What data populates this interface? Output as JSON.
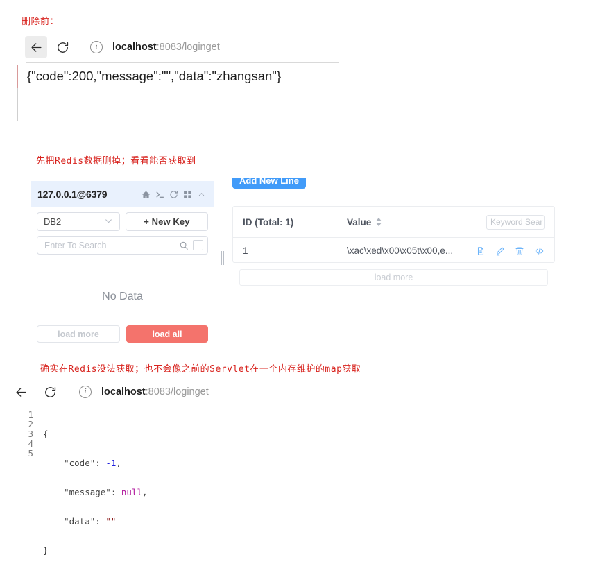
{
  "annotations": {
    "before_delete": "删除前：",
    "delete_redis_first": "先把Redis数据删掉；看看能否获取到",
    "cannot_get": "确实在Redis没法获取；也不会像之前的Servlet在一个内存维护的map获取"
  },
  "browser_top": {
    "back_icon": "back-arrow-icon",
    "reload_icon": "reload-icon",
    "site_info_icon": "info-circle-icon",
    "url_host": "localhost",
    "url_path": ":8083/loginget",
    "page_body": "{\"code\":200,\"message\":\"\",\"data\":\"zhangsan\"}"
  },
  "redis_tool": {
    "left_panel": {
      "connection": "127.0.0.1@6379",
      "header_icons": [
        "home-icon",
        "terminal-icon",
        "refresh-icon",
        "grid-icon",
        "chevron-up-icon"
      ],
      "db_select": "DB2",
      "new_key_button": "+ New Key",
      "search_placeholder": "Enter To Search",
      "search_icon": "magnifier-icon",
      "empty_state": "No Data",
      "load_more_button": "load more",
      "load_all_button": "load all"
    },
    "right_panel": {
      "add_new_line_button": "Add New Line",
      "columns": {
        "id": "ID (Total: 1)",
        "value": "Value"
      },
      "keyword_search_placeholder": "Keyword Sear",
      "rows": [
        {
          "id": "1",
          "value": "\\xac\\xed\\x00\\x05t\\x00,e...",
          "actions": [
            "detail-icon",
            "edit-icon",
            "delete-icon",
            "code-icon"
          ]
        }
      ],
      "load_more_button": "load more"
    },
    "colors": {
      "header_bg": "#e9f1fd",
      "primary_blue": "#419bf9",
      "danger_red": "#f4736c",
      "action_icon_blue": "#6cb4fa"
    }
  },
  "browser_bottom": {
    "back_icon": "back-arrow-icon",
    "reload_icon": "reload-icon",
    "site_info_icon": "info-circle-icon",
    "url_host": "localhost",
    "url_path": ":8083/loginget",
    "json": {
      "line_numbers": [
        "1",
        "2",
        "3",
        "4",
        "5"
      ],
      "lines": [
        "{",
        "    \"code\": -1,",
        "    \"message\": null,",
        "    \"data\": \"\"",
        "}"
      ],
      "code_value": "-1",
      "message_value": "null",
      "data_value": "\"\""
    }
  }
}
